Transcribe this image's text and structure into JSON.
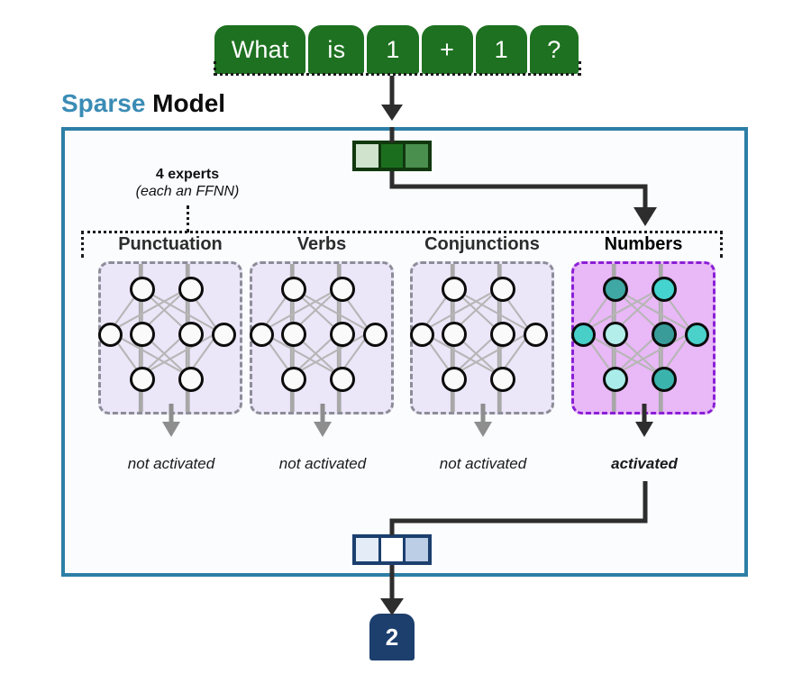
{
  "diagram": {
    "title_highlight": "Sparse",
    "title_rest": " Model",
    "title_highlight_color": "#3a8cb5",
    "container_border_color": "#2d7fa6"
  },
  "input": {
    "tokens": [
      "What",
      "is",
      "1",
      "+",
      "1",
      "?"
    ],
    "token_color": "#1e7121",
    "token_text_color": "#ffffff"
  },
  "router": {
    "note_line1": "4 experts",
    "note_line2": "(each an FFNN)",
    "input_vector": {
      "cells": [
        "#cfe3cd",
        "#1b6e1e",
        "#4b8f4e"
      ]
    }
  },
  "experts": [
    {
      "name": "Punctuation",
      "status": "not activated",
      "active": false
    },
    {
      "name": "Verbs",
      "status": "not activated",
      "active": false
    },
    {
      "name": "Conjunctions",
      "status": "not activated",
      "active": false
    },
    {
      "name": "Numbers",
      "status": "activated",
      "active": true
    }
  ],
  "expert_style": {
    "inactive_bg": "#ece6f9",
    "inactive_border": "#8d8d99",
    "active_bg": "#e9b8f7",
    "active_border": "#8b1fd6",
    "inactive_node": "#fafafa",
    "active_nodes": {
      "top": [
        "#3fa8a4",
        "#45d3cf"
      ],
      "mid": [
        "#47cfc8",
        "#b3eeea",
        "#399c99",
        "#4ad1ca"
      ],
      "bottom": [
        "#a9ecea",
        "#3bb3ad"
      ]
    }
  },
  "output": {
    "vector_cells": [
      "#e3ecf7",
      "#ffffff",
      "#bccde6"
    ],
    "answer": "2",
    "answer_bg": "#1d3f6e"
  }
}
